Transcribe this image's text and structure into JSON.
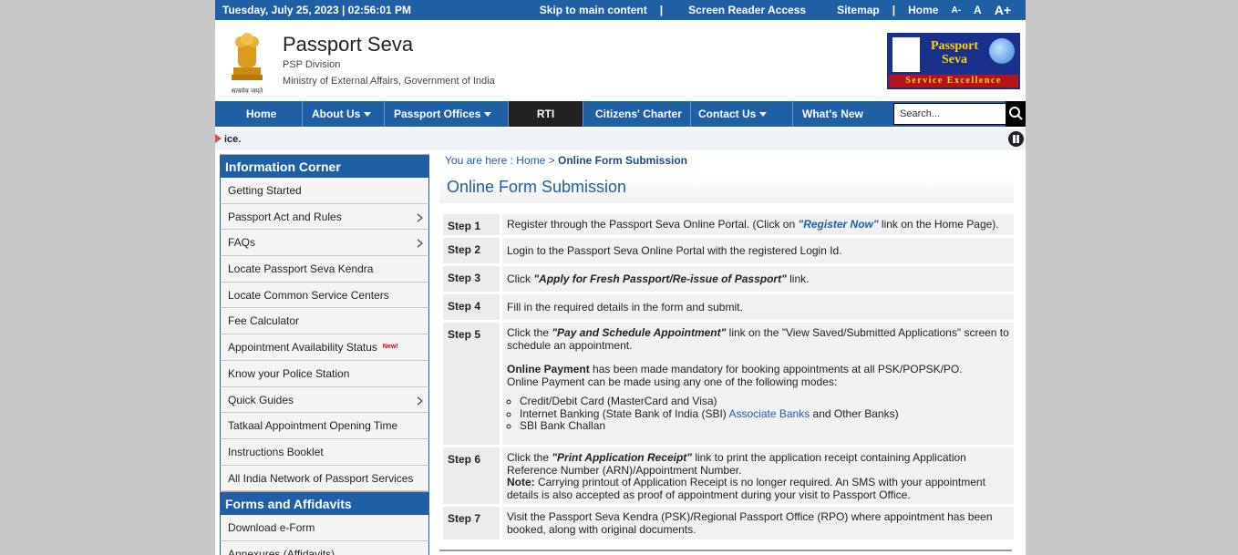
{
  "topbar": {
    "datetime": "Tuesday,  July  25, 2023 | 02:56:01 PM",
    "skip": "Skip to main content",
    "screen_reader": "Screen Reader Access",
    "sitemap": "Sitemap",
    "home": "Home",
    "font_small": "A-",
    "font_normal": "A",
    "font_large": "A+",
    "sep": "|"
  },
  "header": {
    "title": "Passport Seva",
    "division": "PSP Division",
    "ministry": "Ministry of External Affairs, Government of India",
    "emblem_motto": "सत्यमेव जयते",
    "logo_text": "Passport Seva",
    "logo_tagline": "Service Excellence"
  },
  "nav": {
    "items": [
      "Home",
      "About Us",
      "Passport Offices",
      "RTI",
      "Citizens' Charter",
      "Contact Us",
      "What's New"
    ],
    "search_placeholder": "Search..."
  },
  "ticker": {
    "text": "ice."
  },
  "sidebar": {
    "info_heading": "Information Corner",
    "info_items": [
      "Getting Started",
      "Passport Act and Rules",
      "FAQs",
      "Locate Passport Seva Kendra",
      "Locate Common Service Centers",
      "Fee Calculator",
      "Appointment Availability Status",
      "Know your Police Station",
      "Quick Guides",
      "Tatkaal Appointment Opening Time",
      "Instructions Booklet",
      "All India Network of Passport Services"
    ],
    "new_badge": "New!",
    "forms_heading": "Forms and Affidavits",
    "forms_items": [
      "Download e-Form",
      "Annexures (Affidavits)"
    ]
  },
  "main": {
    "breadcrumb_prefix": "You are here : ",
    "breadcrumb_home": "Home",
    "breadcrumb_sep": " > ",
    "breadcrumb_current": "Online Form Submission",
    "title": "Online Form Submission",
    "steps": [
      {
        "label": "Step 1",
        "t1": "Register through the Passport Seva Online Portal. (Click on ",
        "link": "\"Register Now\"",
        "t2": " link on the Home Page)."
      },
      {
        "label": "Step 2",
        "t1": "Login to the Passport Seva Online Portal with the registered Login Id."
      },
      {
        "label": "Step 3",
        "t1": "Click ",
        "em": "\"Apply for Fresh Passport/Re-issue of Passport\"",
        "t2": " link."
      },
      {
        "label": "Step 4",
        "t1": "Fill in the required details in the form and submit."
      },
      {
        "label": "Step 5",
        "t1": "Click the ",
        "em": "\"Pay and Schedule Appointment\"",
        "t2": " link on the \"View Saved/Submitted Applications\" screen to schedule an appointment.",
        "online_bold": "Online Payment",
        "online_rest": " has been made mandatory for booking appointments at all PSK/POPSK/PO.",
        "online_line2": "Online Payment can be made using any one of the following modes:",
        "modes": [
          "Credit/Debit Card (MasterCard and Visa)",
          "Internet Banking (State Bank of India (SBI) ",
          "SBI Bank Challan"
        ],
        "assoc_link": "Associate Banks",
        "assoc_after": " and Other Banks)"
      },
      {
        "label": "Step 6",
        "t1": "Click the ",
        "em": "\"Print Application Receipt\"",
        "t2": " link to print the application receipt containing Application Reference Number (ARN)/Appointment Number.",
        "note_bold": "Note:",
        "note_rest": " Carrying printout of Application Receipt is no longer required. An SMS with your appointment details is also accepted as proof of appointment during your visit to Passport Office."
      },
      {
        "label": "Step 7",
        "t1": "Visit the Passport Seva Kendra (PSK)/Regional Passport Office (RPO) where appointment has been booked, along with original documents."
      }
    ]
  },
  "colors": {
    "brand_blue": "#1f5fa3",
    "rti_black": "#222222",
    "new_red": "#cc0000"
  }
}
